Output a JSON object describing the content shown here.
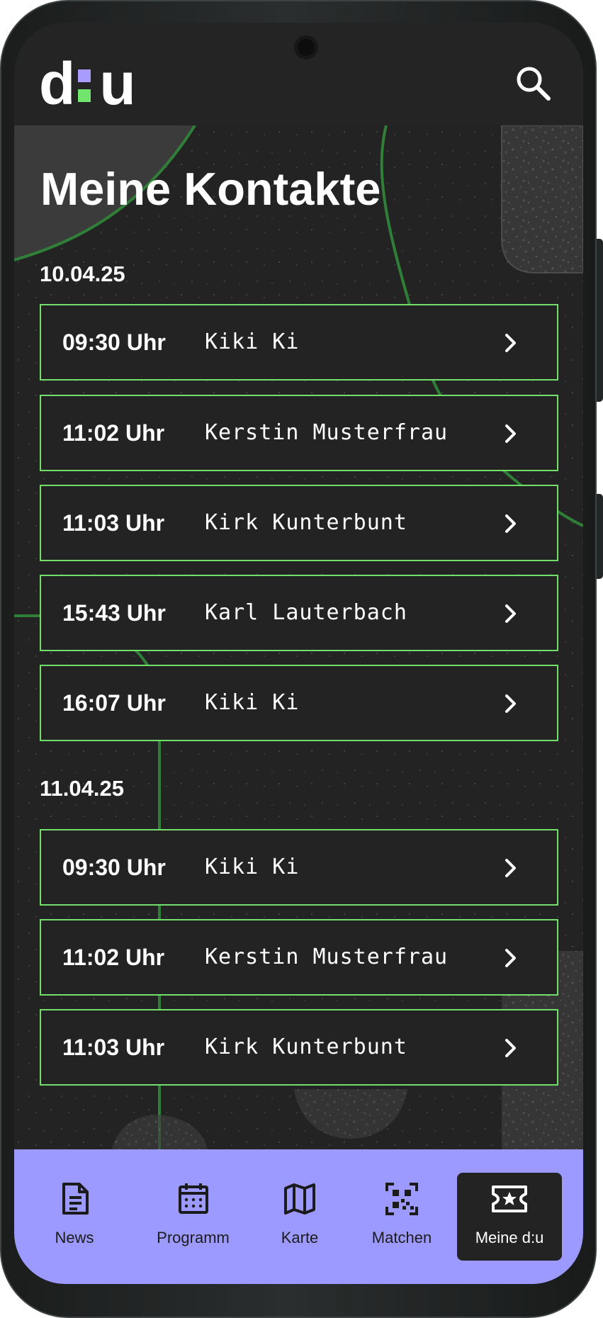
{
  "app": {
    "name": "d:u",
    "brand_text_left": "d",
    "brand_text_right": "u",
    "accent_green": "#72df6b",
    "accent_purple": "#9c9aff",
    "logo_top_dot_color": "#a99cff"
  },
  "header": {
    "search_icon": "search-icon"
  },
  "page": {
    "title": "Meine Kontakte"
  },
  "contacts": {
    "groups": [
      {
        "date": "10.04.25",
        "items": [
          {
            "time": "09:30 Uhr",
            "name": "Kiki Ki",
            "icon": "chevron-right-icon"
          },
          {
            "time": "11:02 Uhr",
            "name": "Kerstin Musterfrau",
            "icon": "chevron-right-icon"
          },
          {
            "time": "11:03 Uhr",
            "name": "Kirk Kunterbunt",
            "icon": "chevron-right-icon"
          },
          {
            "time": "15:43 Uhr",
            "name": "Karl Lauterbach",
            "icon": "chevron-right-icon"
          },
          {
            "time": "16:07 Uhr",
            "name": "Kiki Ki",
            "icon": "chevron-right-icon"
          }
        ]
      },
      {
        "date": "11.04.25",
        "items": [
          {
            "time": "09:30 Uhr",
            "name": "Kiki Ki",
            "icon": "chevron-right-icon"
          },
          {
            "time": "11:02 Uhr",
            "name": "Kerstin Musterfrau",
            "icon": "chevron-right-icon"
          },
          {
            "time": "11:03 Uhr",
            "name": "Kirk Kunterbunt",
            "icon": "chevron-right-icon"
          }
        ]
      }
    ]
  },
  "bottom_nav": {
    "items": [
      {
        "label": "News",
        "icon": "news-icon",
        "active": false
      },
      {
        "label": "Programm",
        "icon": "calendar-icon",
        "active": false
      },
      {
        "label": "Karte",
        "icon": "map-icon",
        "active": false
      },
      {
        "label": "Matchen",
        "icon": "qr-code-icon",
        "active": false
      },
      {
        "label": "Meine d:u",
        "icon": "ticket-star-icon",
        "active": true
      }
    ]
  }
}
